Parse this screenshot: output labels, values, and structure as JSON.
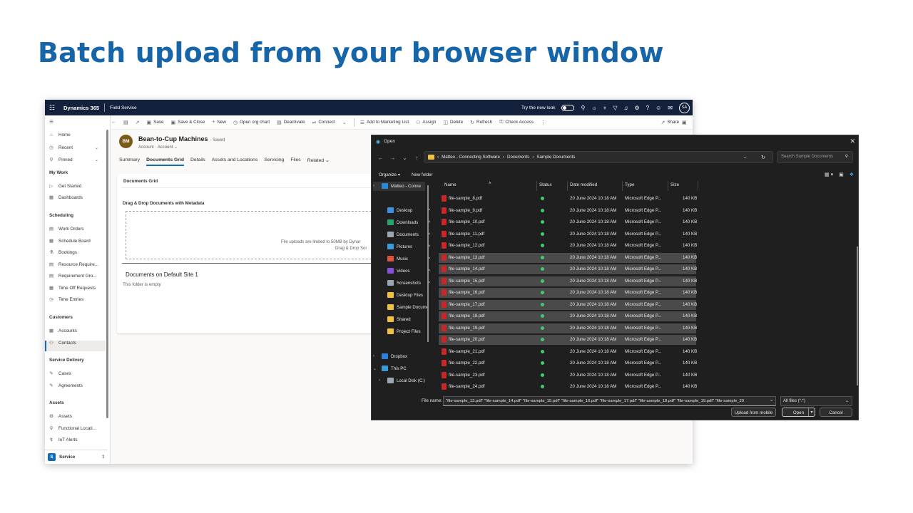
{
  "headline": "Batch upload from your browser window",
  "d365": {
    "app_name": "Dynamics 365",
    "area_name": "Field Service",
    "try_new_look": "Try the new look",
    "user_initials": "SA",
    "commands": [
      "Save",
      "Save & Close",
      "New",
      "Open org chart",
      "Deactivate",
      "Connect",
      "Add to Marketing List",
      "Assign",
      "Delete",
      "Refresh",
      "Check Access"
    ],
    "share": "Share",
    "sidebar": {
      "top_items": [
        "Home",
        "Recent",
        "Pinned"
      ],
      "groups": [
        {
          "title": "My Work",
          "items": [
            "Get Started",
            "Dashboards"
          ]
        },
        {
          "title": "Scheduling",
          "items": [
            "Work Orders",
            "Schedule Board",
            "Bookings",
            "Resource Require...",
            "Requirement Gro...",
            "Time Off Requests",
            "Time Entries"
          ]
        },
        {
          "title": "Customers",
          "items": [
            "Accounts",
            "Contacts"
          ]
        },
        {
          "title": "Service Delivery",
          "items": [
            "Cases",
            "Agreements"
          ]
        },
        {
          "title": "Assets",
          "items": [
            "Assets",
            "Functional Locati...",
            "IoT Alerts"
          ]
        }
      ],
      "area_switcher": "Service",
      "area_letter": "S"
    },
    "record": {
      "initials": "BM",
      "title": "Bean-to-Cup Machines",
      "saved": "- Saved",
      "entity": "Account",
      "form": "Account",
      "tabs": [
        "Summary",
        "Documents Grid",
        "Details",
        "Assets and Locations",
        "Servicing",
        "Files",
        "Related"
      ],
      "active_tab": "Documents Grid"
    },
    "documents": {
      "section_title": "Documents Grid",
      "dnd_title": "Drag & Drop Documents with Metadata",
      "limit_text": "File uploads are limited to 50MB by Dynar",
      "dnd_hint": "Drag & Drop Sor",
      "site_title": "Documents on Default Site 1",
      "empty_text": "This folder is empty"
    }
  },
  "dialog": {
    "title": "Open",
    "breadcrumb": [
      "Matteo - Connecting Software",
      "Documents",
      "Sample Documents"
    ],
    "search_placeholder": "Search Sample Documents",
    "organize": "Organize",
    "new_folder": "New folder",
    "nav": [
      {
        "label": "Matteo - Conne",
        "icon_color": "#2b88d8"
      },
      {
        "label": "Desktop",
        "icon_color": "#3d8fe0"
      },
      {
        "label": "Downloads",
        "icon_color": "#2aa36b"
      },
      {
        "label": "Documents",
        "icon_color": "#9aa6b2"
      },
      {
        "label": "Pictures",
        "icon_color": "#3a9ad9"
      },
      {
        "label": "Music",
        "icon_color": "#e0533d"
      },
      {
        "label": "Videos",
        "icon_color": "#8a4fd8"
      },
      {
        "label": "Screenshots",
        "icon_color": "#9aa6b2"
      },
      {
        "label": "Desktop Files",
        "icon_color": "#f0c040"
      },
      {
        "label": "Sample Docume",
        "icon_color": "#f0c040"
      },
      {
        "label": "Shared",
        "icon_color": "#f0c040"
      },
      {
        "label": "Project Files",
        "icon_color": "#f0c040"
      },
      {
        "label": "Dropbox",
        "icon_color": "#2f7fe0"
      },
      {
        "label": "This PC",
        "icon_color": "#3a9ad9"
      },
      {
        "label": "Local Disk (C:)",
        "icon_color": "#9aa6b2"
      }
    ],
    "columns": [
      "Name",
      "Status",
      "Date modified",
      "Type",
      "Size"
    ],
    "files": [
      {
        "name": "file-sample_8.pdf",
        "selected": false
      },
      {
        "name": "file-sample_9.pdf",
        "selected": false
      },
      {
        "name": "file-sample_10.pdf",
        "selected": false
      },
      {
        "name": "file-sample_11.pdf",
        "selected": false
      },
      {
        "name": "file-sample_12.pdf",
        "selected": false
      },
      {
        "name": "file-sample_13.pdf",
        "selected": true
      },
      {
        "name": "file-sample_14.pdf",
        "selected": true
      },
      {
        "name": "file-sample_15.pdf",
        "selected": true
      },
      {
        "name": "file-sample_16.pdf",
        "selected": true
      },
      {
        "name": "file-sample_17.pdf",
        "selected": true
      },
      {
        "name": "file-sample_18.pdf",
        "selected": true
      },
      {
        "name": "file-sample_19.pdf",
        "selected": true
      },
      {
        "name": "file-sample_20.pdf",
        "selected": true
      },
      {
        "name": "file-sample_21.pdf",
        "selected": false
      },
      {
        "name": "file-sample_22.pdf",
        "selected": false
      },
      {
        "name": "file-sample_23.pdf",
        "selected": false
      },
      {
        "name": "file-sample_24.pdf",
        "selected": false
      }
    ],
    "file_date": "20 June 2024 10:18 AM",
    "file_type": "Microsoft Edge P...",
    "file_size": "140 KB",
    "file_name_label": "File name:",
    "file_name_value": "\"file-sample_13.pdf\" \"file-sample_14.pdf\" \"file-sample_15.pdf\" \"file-sample_16.pdf\" \"file-sample_17.pdf\" \"file-sample_18.pdf\" \"file-sample_19.pdf\" \"file-sample_20",
    "file_type_filter": "All files (*.*)",
    "upload_mobile": "Upload from mobile",
    "open_button": "Open",
    "cancel_button": "Cancel"
  }
}
